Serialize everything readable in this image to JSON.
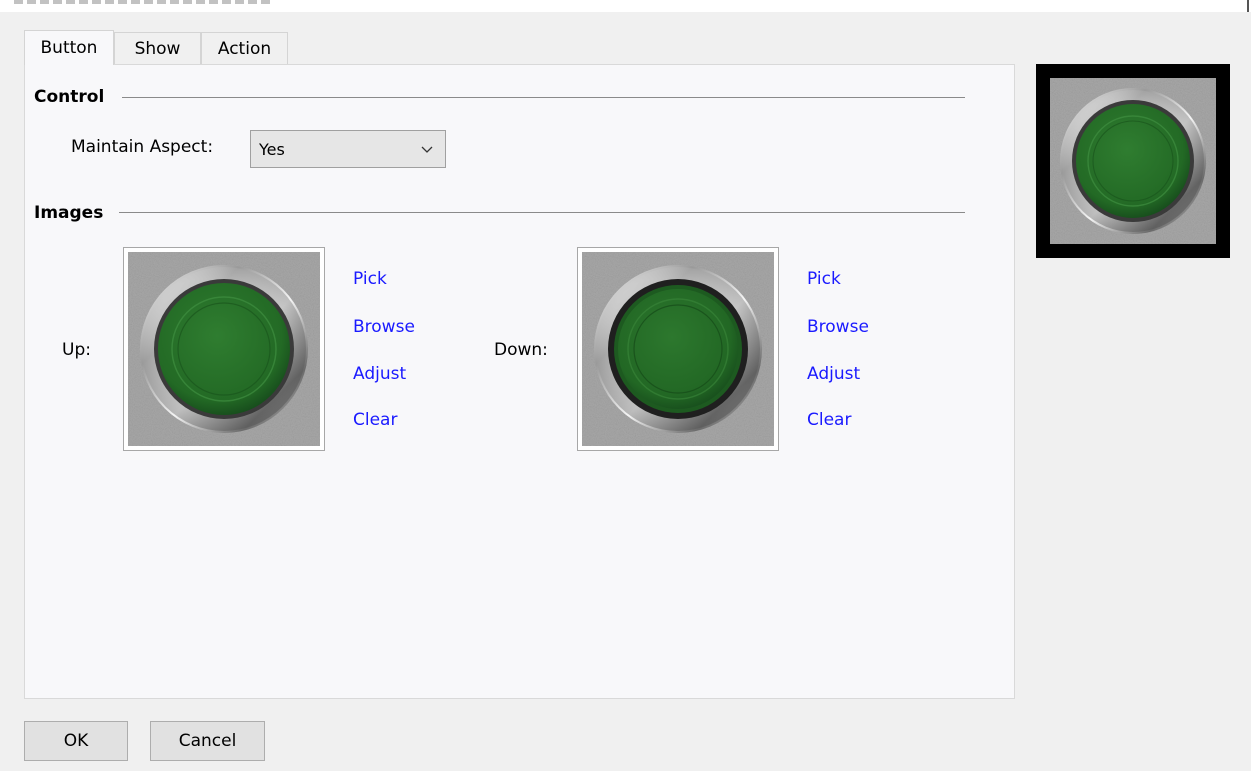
{
  "tabs": [
    {
      "label": "Button",
      "active": true
    },
    {
      "label": "Show",
      "active": false
    },
    {
      "label": "Action",
      "active": false
    }
  ],
  "control": {
    "title": "Control",
    "maintain_aspect_label": "Maintain Aspect:",
    "maintain_aspect_value": "Yes"
  },
  "images": {
    "title": "Images",
    "up_label": "Up:",
    "down_label": "Down:",
    "up_links": [
      "Pick",
      "Browse",
      "Adjust",
      "Clear"
    ],
    "down_links": [
      "Pick",
      "Browse",
      "Adjust",
      "Clear"
    ]
  },
  "buttons": {
    "ok": "OK",
    "cancel": "Cancel"
  },
  "colors": {
    "link": "#1a1aff",
    "button_green": "#2d7a2d",
    "panel_bg": "#f8f8fa"
  },
  "icons": {
    "up_image": "green-round-button-up",
    "down_image": "green-round-button-down",
    "preview": "green-round-button-preview",
    "dropdown": "chevron-down-icon"
  }
}
